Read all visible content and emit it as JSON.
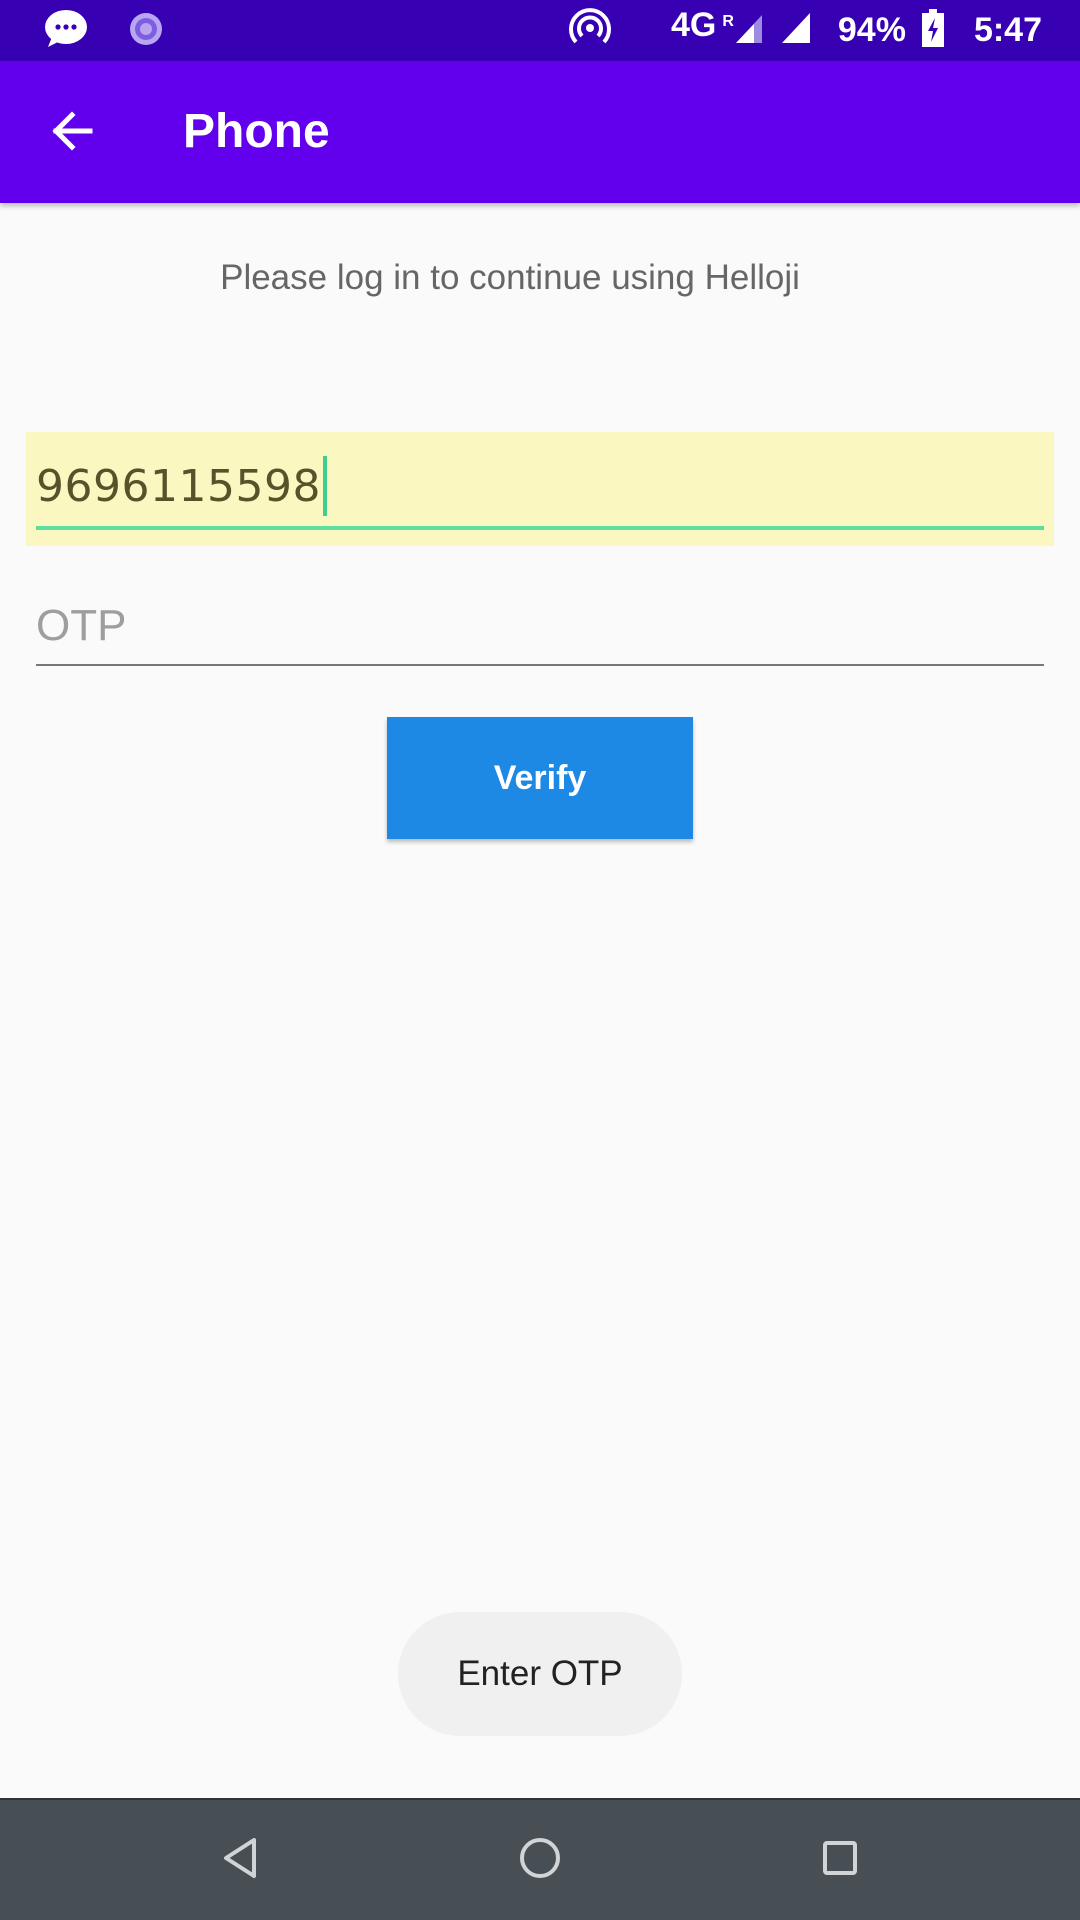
{
  "status_bar": {
    "network_label": "4G",
    "roaming_label": "R",
    "battery_percent": "94%",
    "time": "5:47",
    "icons": [
      "chat-bubble-icon",
      "sync-icon",
      "hotspot-icon",
      "signal-icon",
      "signal-icon",
      "battery-charging-icon"
    ]
  },
  "app_bar": {
    "title": "Phone",
    "back_icon": "arrow-back-icon",
    "background": "#6200ee"
  },
  "content": {
    "subtitle": "Please log in to continue using Helloji",
    "phone_field": {
      "value": "9696115598"
    },
    "otp_field": {
      "placeholder": "OTP",
      "value": ""
    },
    "verify_button": {
      "label": "Verify",
      "color": "#1e88e5"
    }
  },
  "toast": {
    "message": "Enter OTP"
  },
  "nav_bar": {
    "icons": [
      "nav-back-icon",
      "nav-home-icon",
      "nav-recents-icon"
    ]
  }
}
